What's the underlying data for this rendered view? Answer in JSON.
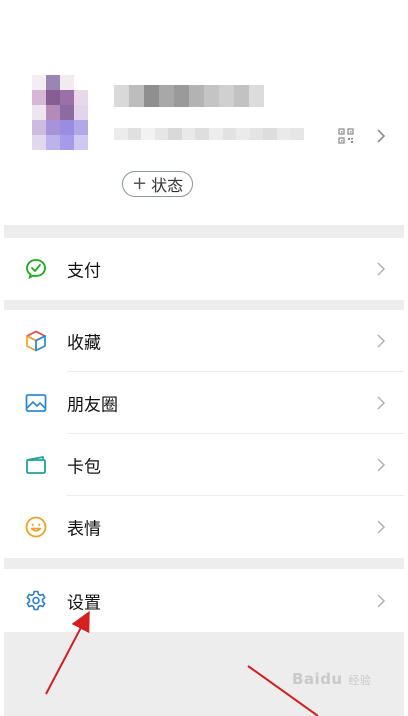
{
  "profile": {
    "status_button_label": "状态",
    "status_button_prefix": "+"
  },
  "menu": {
    "pay": {
      "label": "支付",
      "icon": "wechat-pay-icon"
    },
    "favorites": {
      "label": "收藏",
      "icon": "cube-icon"
    },
    "moments": {
      "label": "朋友圈",
      "icon": "image-icon"
    },
    "cards": {
      "label": "卡包",
      "icon": "card-icon"
    },
    "stickers": {
      "label": "表情",
      "icon": "smiley-icon"
    },
    "settings": {
      "label": "设置",
      "icon": "gear-icon"
    }
  },
  "watermark": {
    "text": "Baidu",
    "sub": "经验"
  },
  "colors": {
    "pay_green": "#1aad19",
    "moments_blue": "#2a8cd6",
    "cards_teal": "#1ba39c",
    "stickers_orange": "#f0a020",
    "settings_blue": "#2a7fd0",
    "arrow_red": "#d42020"
  }
}
